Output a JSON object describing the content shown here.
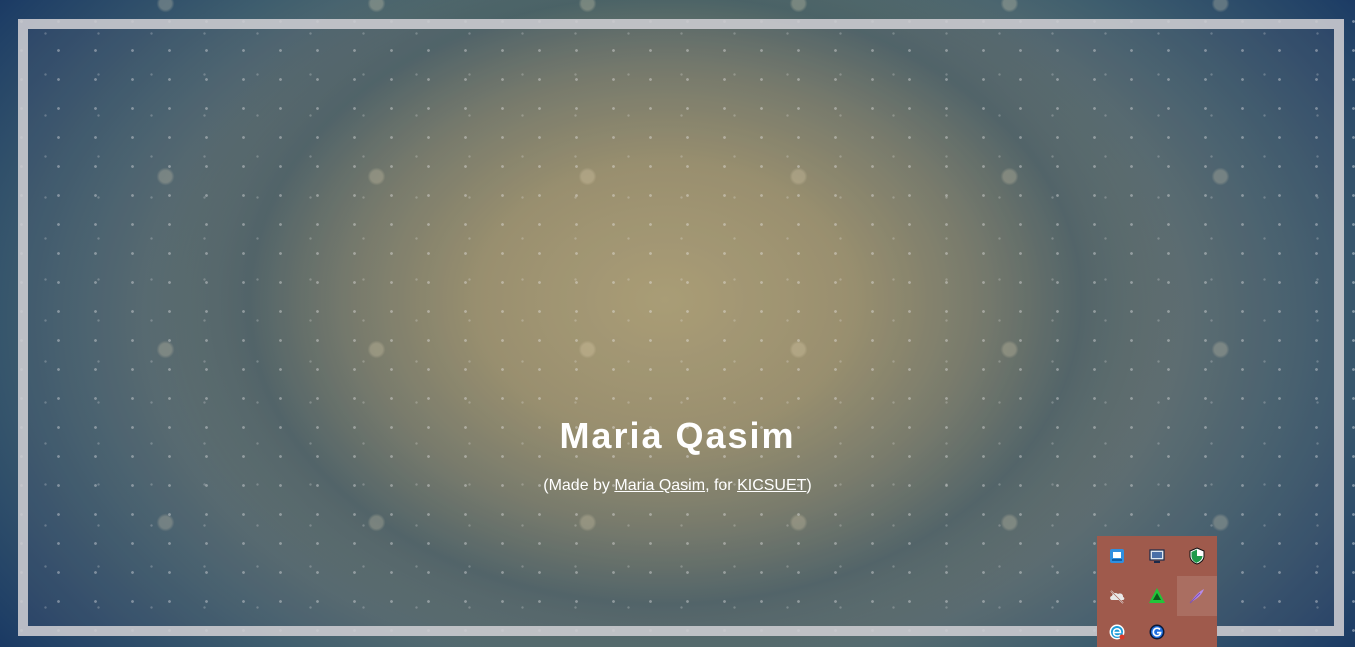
{
  "hero": {
    "title": "Maria Qasim",
    "credit_prefix": "(Made by ",
    "author_link": "Maria Qasim",
    "credit_middle": ", for ",
    "org_link": "KICSUET",
    "credit_suffix": ")"
  },
  "system_tray": {
    "icons": [
      "network-adapter-icon",
      "display-monitor-icon",
      "security-shield-icon",
      "cloud-offline-icon",
      "green-triangle-app-icon",
      "pen-feather-icon",
      "edge-browser-icon",
      "blue-g-app-icon"
    ]
  },
  "colors": {
    "tray_background": "#9f5a4c",
    "frame_border": "#cdcdd2",
    "text": "#ffffff"
  }
}
